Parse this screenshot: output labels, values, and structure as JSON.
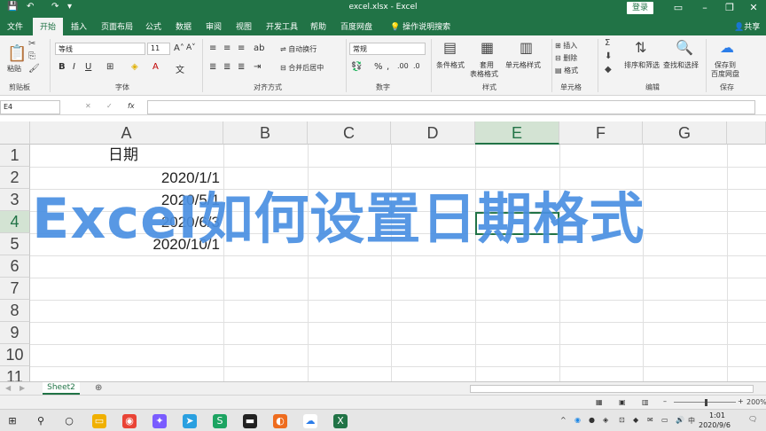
{
  "window": {
    "title": "excel.xlsx - Excel",
    "login": "登录"
  },
  "tabs": [
    {
      "label": "文件"
    },
    {
      "label": "开始"
    },
    {
      "label": "插入"
    },
    {
      "label": "页面布局"
    },
    {
      "label": "公式"
    },
    {
      "label": "数据"
    },
    {
      "label": "审阅"
    },
    {
      "label": "视图"
    },
    {
      "label": "开发工具"
    },
    {
      "label": "帮助"
    },
    {
      "label": "百度网盘"
    }
  ],
  "tell_me": "操作说明搜索",
  "share": "共享",
  "ribbon": {
    "paste": "粘贴",
    "font_name": "等线",
    "font_size": "11",
    "wrap_text": "自动换行",
    "merge_center": "合并后居中",
    "number_format": "常规",
    "conditional": "条件格式",
    "table_format": "套用",
    "table_format2": "表格格式",
    "cell_style": "单元格样式",
    "insert": "插入",
    "delete": "删除",
    "format": "格式",
    "sort_filter": "排序和筛选",
    "find_select": "查找和选择",
    "save_to": "保存到",
    "save_to2": "百度网盘",
    "groups": {
      "clipboard": "剪贴板",
      "font": "字体",
      "alignment": "对齐方式",
      "number": "数字",
      "styles": "样式",
      "cells": "单元格",
      "editing": "编辑",
      "save": "保存"
    }
  },
  "formula_bar": {
    "name_box": "E4",
    "fx": "fx",
    "cancel": "✕",
    "enter": "✓"
  },
  "columns": [
    "A",
    "B",
    "C",
    "D",
    "E",
    "F",
    "G"
  ],
  "rows": [
    "1",
    "2",
    "3",
    "4",
    "5",
    "6",
    "7",
    "8",
    "9",
    "10",
    "11"
  ],
  "cells": {
    "A1": "日期",
    "A2": "2020/1/1",
    "A3": "2020/5/1",
    "A4": "2020/6/3",
    "A5": "2020/10/1"
  },
  "overlay_caption": "Excel如何设置日期格式",
  "sheet_tab": "Sheet2",
  "add_sheet": "⊕",
  "zoom": "200%",
  "clock": {
    "time": "1:01",
    "date": "2020/9/6"
  },
  "colors": {
    "excel_green": "#217346",
    "caption_blue": "#4a90e2"
  }
}
